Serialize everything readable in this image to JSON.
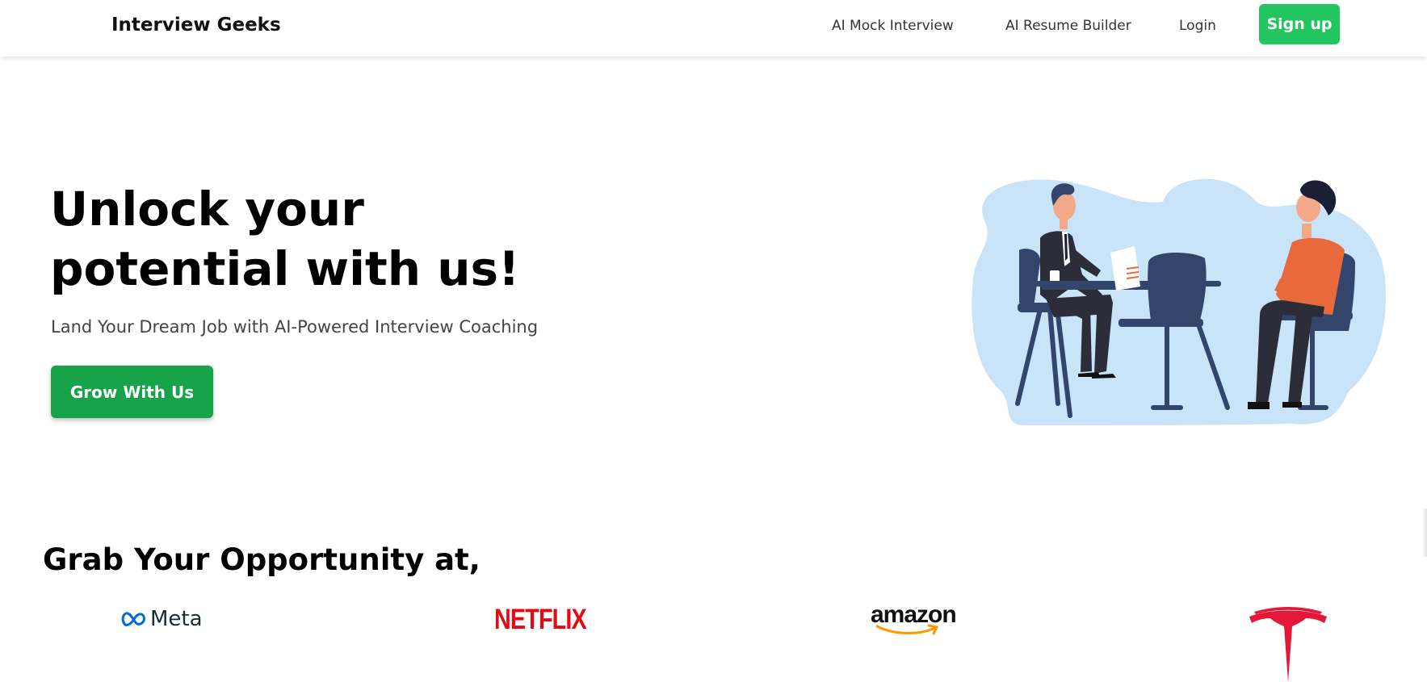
{
  "navbar": {
    "brand": "Interview Geeks",
    "links": [
      "AI Mock Interview",
      "AI Resume Builder",
      "Login"
    ],
    "signup_label": "Sign up"
  },
  "hero": {
    "title_line1": "Unlock your",
    "title_line2": "potential with us!",
    "subtitle": "Land Your Dream Job with AI-Powered Interview Coaching",
    "cta_label": "Grow With Us",
    "illustration": "interview-illustration"
  },
  "companies": {
    "heading": "Grab Your Opportunity at,",
    "logos": [
      {
        "name": "Meta",
        "text": "Meta",
        "icon": "meta-logo"
      },
      {
        "name": "Netflix",
        "text": "NETFLIX",
        "icon": "netflix-logo"
      },
      {
        "name": "Amazon",
        "text": "amazon",
        "icon": "amazon-logo"
      },
      {
        "name": "Tesla",
        "text": "",
        "icon": "tesla-logo"
      }
    ]
  },
  "colors": {
    "signup_green": "#22c55e",
    "cta_green": "#16a34a",
    "netflix_red": "#e50914",
    "tesla_red": "#e31937",
    "meta_blue": "#0668e1",
    "amazon_orange": "#ff9900",
    "illustration_bg": "#c9e3f9",
    "illustration_navy": "#33456a",
    "illustration_orange": "#e8693c"
  }
}
